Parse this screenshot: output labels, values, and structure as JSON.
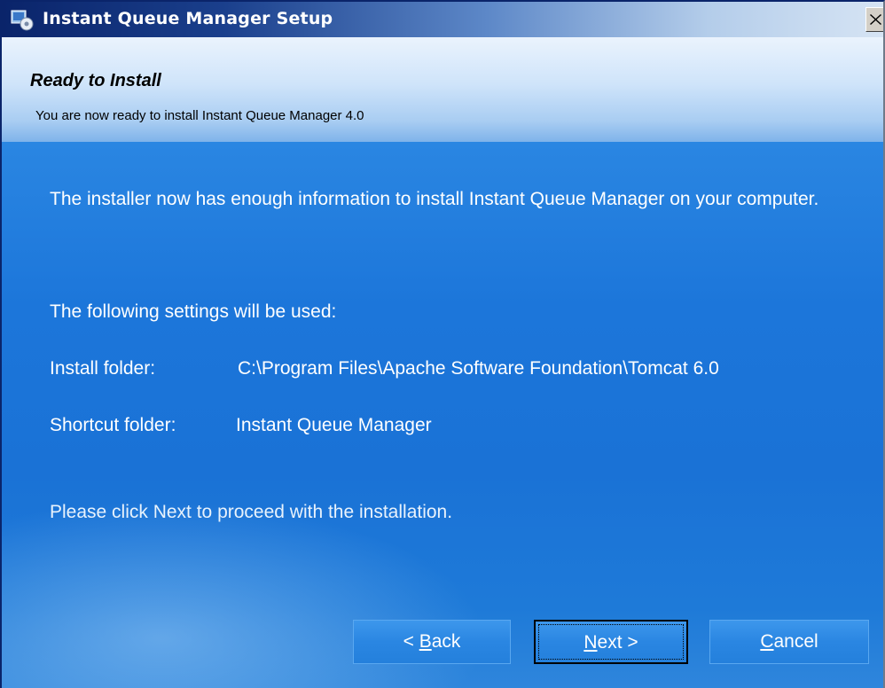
{
  "window": {
    "title": "Instant Queue Manager Setup"
  },
  "header": {
    "title": "Ready to Install",
    "subtitle": "You are now ready to install Instant Queue Manager 4.0"
  },
  "content": {
    "intro": "The installer now has enough information to install Instant Queue Manager on your computer.",
    "settings_heading": "The following settings will be used:",
    "install_folder_label": "Install folder:",
    "install_folder_value": "C:\\Program Files\\Apache Software Foundation\\Tomcat 6.0",
    "shortcut_folder_label": "Shortcut folder:",
    "shortcut_folder_value": "Instant Queue Manager",
    "proceed_text": "Please click Next to proceed with the installation."
  },
  "buttons": {
    "back": {
      "prefix": "< ",
      "accel": "B",
      "rest": "ack"
    },
    "next": {
      "accel": "N",
      "rest": "ext >"
    },
    "cancel": {
      "accel": "C",
      "rest": "ancel"
    }
  },
  "icons": {
    "app": "installer-app-icon",
    "close": "close-icon"
  },
  "colors": {
    "title_bar": "#0a246a",
    "body_background": "#1c74d8",
    "header_background": "#cfe4fa"
  }
}
